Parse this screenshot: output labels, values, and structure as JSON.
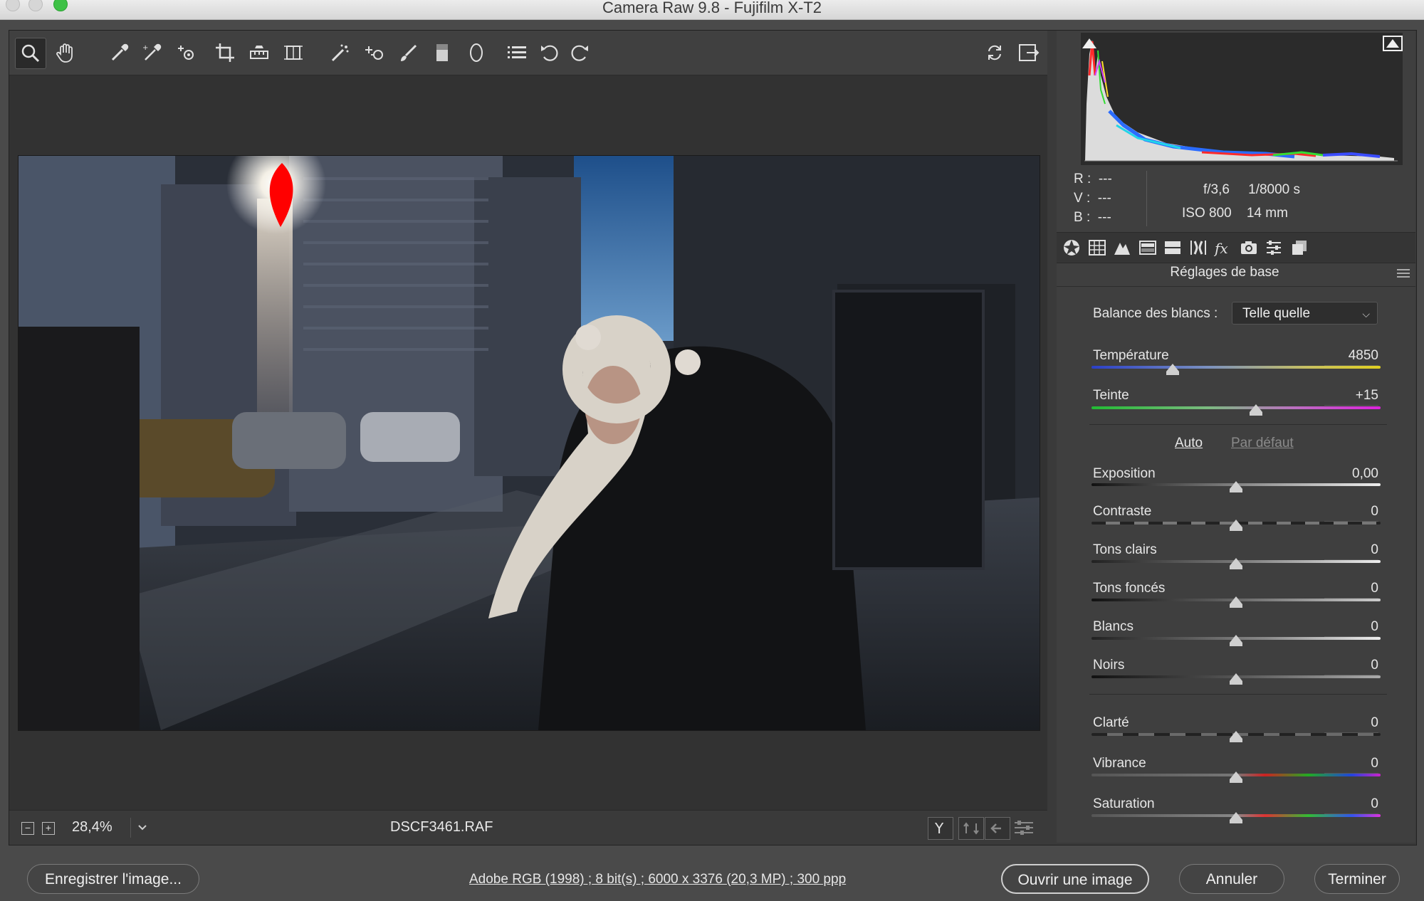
{
  "window": {
    "title": "Camera Raw 9.8  -  Fujifilm X-T2"
  },
  "toolbar": {
    "tools": [
      "zoom-icon",
      "hand-icon",
      "white-balance-icon",
      "color-sampler-icon",
      "targeted-adjustment-icon",
      "crop-icon",
      "straighten-icon",
      "transform-icon",
      "spot-removal-icon",
      "red-eye-icon",
      "adjustment-brush-icon",
      "graduated-filter-icon",
      "radial-filter-icon",
      "preferences-icon",
      "rotate-left-icon",
      "rotate-right-icon"
    ],
    "right_tools": [
      "refresh-icon",
      "fullscreen-icon"
    ]
  },
  "status": {
    "zoom": "28,4%",
    "filename": "DSCF3461.RAF"
  },
  "readout": {
    "r_label": "R :",
    "r_value": "---",
    "v_label": "V :",
    "v_value": "---",
    "b_label": "B :",
    "b_value": "---",
    "aperture": "f/3,6",
    "shutter": "1/8000 s",
    "iso": "ISO 800",
    "focal": "14 mm"
  },
  "panel": {
    "title": "Réglages de base",
    "wb_label": "Balance des blancs :",
    "wb_value": "Telle quelle",
    "auto": "Auto",
    "default": "Par défaut",
    "sliders": [
      {
        "label": "Température",
        "value": "4850",
        "pos": 0.28
      },
      {
        "label": "Teinte",
        "value": "+15",
        "pos": 0.57
      },
      {
        "label": "Exposition",
        "value": "0,00",
        "pos": 0.5
      },
      {
        "label": "Contraste",
        "value": "0",
        "pos": 0.5
      },
      {
        "label": "Tons clairs",
        "value": "0",
        "pos": 0.5
      },
      {
        "label": "Tons foncés",
        "value": "0",
        "pos": 0.5
      },
      {
        "label": "Blancs",
        "value": "0",
        "pos": 0.5
      },
      {
        "label": "Noirs",
        "value": "0",
        "pos": 0.5
      },
      {
        "label": "Clarté",
        "value": "0",
        "pos": 0.5
      },
      {
        "label": "Vibrance",
        "value": "0",
        "pos": 0.5
      },
      {
        "label": "Saturation",
        "value": "0",
        "pos": 0.5
      }
    ]
  },
  "footer": {
    "save": "Enregistrer l'image...",
    "info": "Adobe RGB (1998) ; 8 bit(s) ; 6000 x 3376 (20,3 MP) ; 300 ppp",
    "open": "Ouvrir une image",
    "cancel": "Annuler",
    "done": "Terminer"
  },
  "colors": {
    "clip_warning": "#ff0000",
    "background": "#3f3f3f"
  }
}
